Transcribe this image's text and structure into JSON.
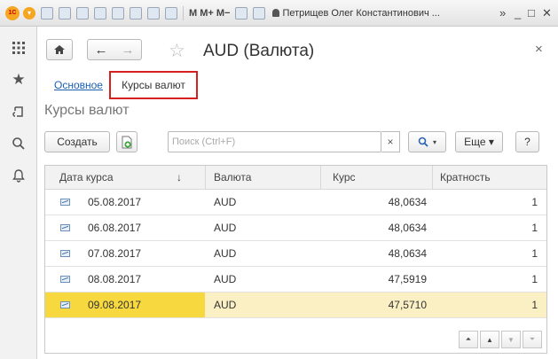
{
  "titlebar": {
    "logo": "1С",
    "toolbar_text": "M  M+  M−",
    "user": "Петрищев Олег Константинович ...",
    "controls": {
      "more": "»",
      "minimize": "_",
      "restore": "□",
      "close": "✕"
    }
  },
  "sidebar": {
    "items": [
      {
        "name": "menu-grid-icon",
        "glyph": "⋮⋮"
      },
      {
        "name": "favorites-icon",
        "glyph": "★"
      },
      {
        "name": "history-icon",
        "glyph": "⎌"
      },
      {
        "name": "search-icon",
        "glyph": "⌕"
      },
      {
        "name": "notifications-icon",
        "glyph": "🔔"
      }
    ]
  },
  "form": {
    "title": "AUD (Валюта)",
    "nav": {
      "home": "⌂",
      "back": "←",
      "forward": "→",
      "star": "☆"
    },
    "close": "×",
    "link_main": "Основное",
    "tab_active": "Курсы валют",
    "section_title": "Курсы валют"
  },
  "commands": {
    "create": "Создать",
    "add_copy_icon": "+",
    "search_placeholder": "Поиск (Ctrl+F)",
    "search_clear": "×",
    "search_button": "🔍 ▾",
    "more": "Еще ▾",
    "help": "?"
  },
  "table": {
    "columns": [
      "Дата курса",
      "↓",
      "Валюта",
      "Курс",
      "Кратность"
    ],
    "rows": [
      {
        "date": "05.08.2017",
        "currency": "AUD",
        "rate": "48,0634",
        "multiplicity": "1",
        "selected": false
      },
      {
        "date": "06.08.2017",
        "currency": "AUD",
        "rate": "48,0634",
        "multiplicity": "1",
        "selected": false
      },
      {
        "date": "07.08.2017",
        "currency": "AUD",
        "rate": "48,0634",
        "multiplicity": "1",
        "selected": false
      },
      {
        "date": "08.08.2017",
        "currency": "AUD",
        "rate": "47,5919",
        "multiplicity": "1",
        "selected": false
      },
      {
        "date": "09.08.2017",
        "currency": "AUD",
        "rate": "47,5710",
        "multiplicity": "1",
        "selected": true
      }
    ],
    "scroll_buttons": [
      "⏶⏶",
      "▲",
      "▼",
      "⏷⏷"
    ]
  },
  "colors": {
    "selected_lead": "#f7d93f",
    "selected_row": "#fbf0c4",
    "active_tab_border": "#d62020",
    "link": "#1a5fb4",
    "logo": "#f5a623"
  }
}
